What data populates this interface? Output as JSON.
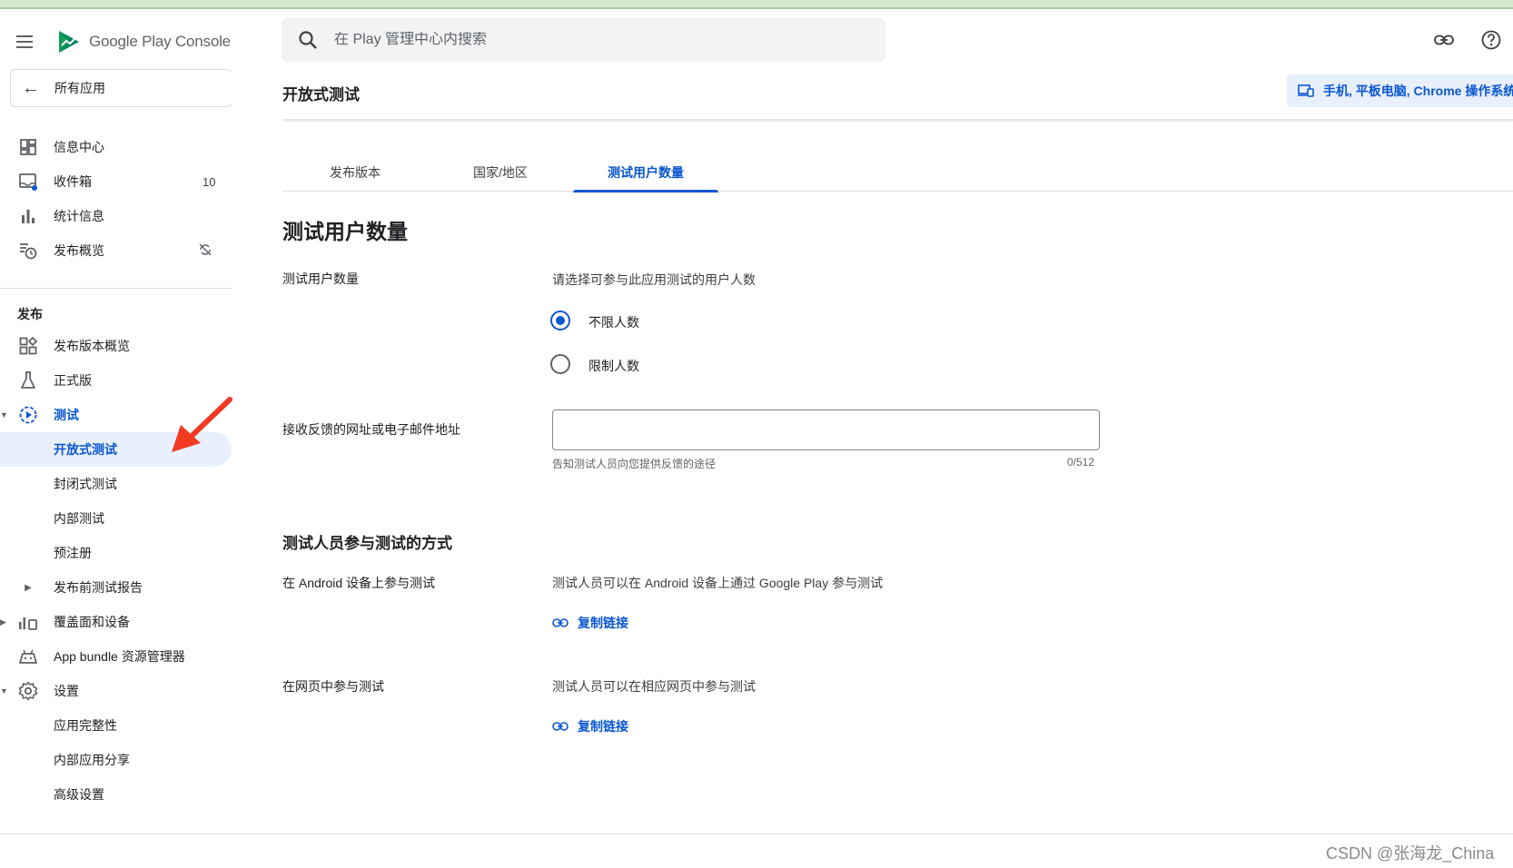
{
  "app": {
    "brand_name": "Google Play Console",
    "all_apps_label": "所有应用"
  },
  "search": {
    "placeholder": "在 Play 管理中心内搜索"
  },
  "sidebar": {
    "top_items": [
      {
        "label": "信息中心",
        "icon": "dashboard-icon"
      },
      {
        "label": "收件箱",
        "icon": "inbox-icon",
        "badge": "10"
      },
      {
        "label": "统计信息",
        "icon": "bar-chart-icon"
      },
      {
        "label": "发布概览",
        "icon": "publishing-overview-icon",
        "status_icon": "sync-off-icon"
      }
    ],
    "section_title": "发布",
    "release_items": [
      {
        "label": "发布版本概览",
        "icon": "releases-overview-icon"
      },
      {
        "label": "正式版",
        "icon": "production-icon"
      },
      {
        "label": "测试",
        "icon": "testing-icon",
        "expanded": true
      },
      {
        "label": "开放式测试",
        "selected": true
      },
      {
        "label": "封闭式测试"
      },
      {
        "label": "内部测试"
      },
      {
        "label": "预注册"
      },
      {
        "label": "发布前测试报告",
        "collapsed": true
      },
      {
        "label": "覆盖面和设备",
        "icon": "reach-devices-icon",
        "collapsed": true
      },
      {
        "label": "App bundle 资源管理器",
        "icon": "app-bundle-icon"
      },
      {
        "label": "设置",
        "icon": "settings-icon",
        "expanded": true
      },
      {
        "label": "应用完整性"
      },
      {
        "label": "内部应用分享"
      },
      {
        "label": "高级设置"
      }
    ]
  },
  "header": {
    "page_title": "开放式测试",
    "device_chip": "手机, 平板电脑, Chrome 操作系统"
  },
  "tabs": [
    {
      "label": "发布版本",
      "selected": false
    },
    {
      "label": "国家/地区",
      "selected": false
    },
    {
      "label": "测试用户数量",
      "selected": true
    }
  ],
  "main": {
    "heading": "测试用户数量",
    "tester_count": {
      "label": "测试用户数量",
      "prompt": "请选择可参与此应用测试的用户人数",
      "options": [
        {
          "label": "不限人数",
          "checked": true
        },
        {
          "label": "限制人数",
          "checked": false
        }
      ]
    },
    "feedback": {
      "label": "接收反馈的网址或电子邮件地址",
      "value": "",
      "helper": "告知测试人员向您提供反馈的途径",
      "counter": "0/512"
    },
    "how_to_join": {
      "heading": "测试人员参与测试的方式",
      "android": {
        "label": "在 Android 设备上参与测试",
        "description": "测试人员可以在 Android 设备上通过 Google Play 参与测试",
        "link": "复制链接"
      },
      "web": {
        "label": "在网页中参与测试",
        "description": "测试人员可以在相应网页中参与测试",
        "link": "复制链接"
      }
    }
  },
  "watermark": "CSDN @张海龙_China",
  "colors": {
    "accent": "#0b57d0",
    "selected_bg": "#e8f0fe",
    "annotation_arrow": "#f23a22"
  }
}
